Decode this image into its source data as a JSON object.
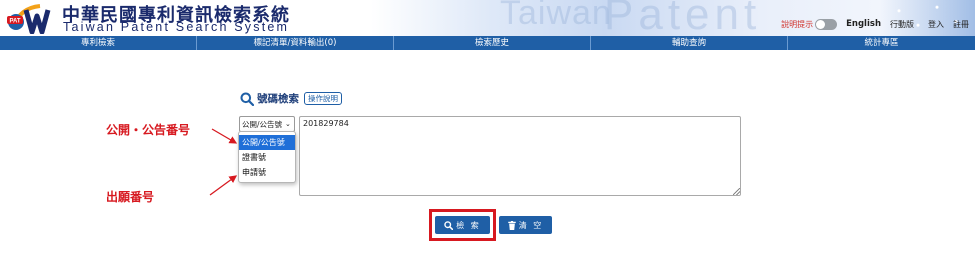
{
  "header": {
    "title_zh": "中華民國專利資訊檢索系統",
    "title_en": "Taiwan Patent Search System",
    "banner_word_1": "Taiwan",
    "banner_word_2": "Patent",
    "logo_label": "PAT",
    "hint_label": "說明提示",
    "hint_toggle_on": false,
    "english": "English",
    "mobile": "行動版",
    "login": "登入",
    "register": "註冊"
  },
  "nav": {
    "items": [
      {
        "label": "專利檢索"
      },
      {
        "label": "標記清單/資料輸出(0)"
      },
      {
        "label": "檢索歷史"
      },
      {
        "label": "輔助查詢"
      },
      {
        "label": "統計專區"
      }
    ]
  },
  "search": {
    "title": "號碼檢索",
    "help_label": "操作說明",
    "select_value": "公開/公告號",
    "options": [
      {
        "label": "公開/公告號",
        "selected": true
      },
      {
        "label": "證書號",
        "selected": false
      },
      {
        "label": "申請號",
        "selected": false
      }
    ],
    "query": "201829784",
    "search_button": "檢 索",
    "clear_button": "清 空"
  },
  "annotations": {
    "label_1": "公開・公告番号",
    "label_2": "出願番号",
    "color": "#d71920"
  },
  "colors": {
    "nav_bg": "#1f5fa6",
    "button_bg": "#1f5fa6",
    "title_color": "#1a2a6c",
    "selected_option": "#1f6fd8"
  }
}
